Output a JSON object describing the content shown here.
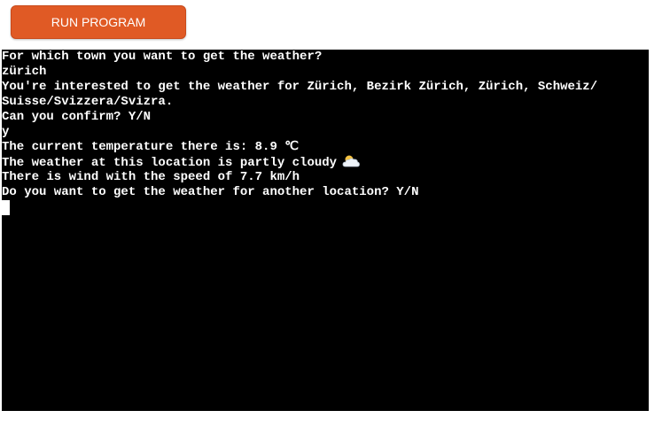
{
  "toolbar": {
    "run_label": "RUN PROGRAM"
  },
  "terminal": {
    "lines": [
      "For which town you want to get the weather?",
      "zürich",
      "You're interested to get the weather for Zürich, Bezirk Zürich, Zürich, Schweiz/",
      "Suisse/Svizzera/Svizra.",
      "Can you confirm? Y/N",
      "y",
      "The current temperature there is: 8.9 ℃",
      "The weather at this location is partly cloudy",
      "There is wind with the speed of 7.7 km/h",
      "Do you want to get the weather for another location? Y/N"
    ],
    "weather_icon": "partly-cloudy-icon"
  },
  "colors": {
    "button": "#e05a25",
    "terminal_bg": "#000000",
    "terminal_text": "#ffffff"
  }
}
